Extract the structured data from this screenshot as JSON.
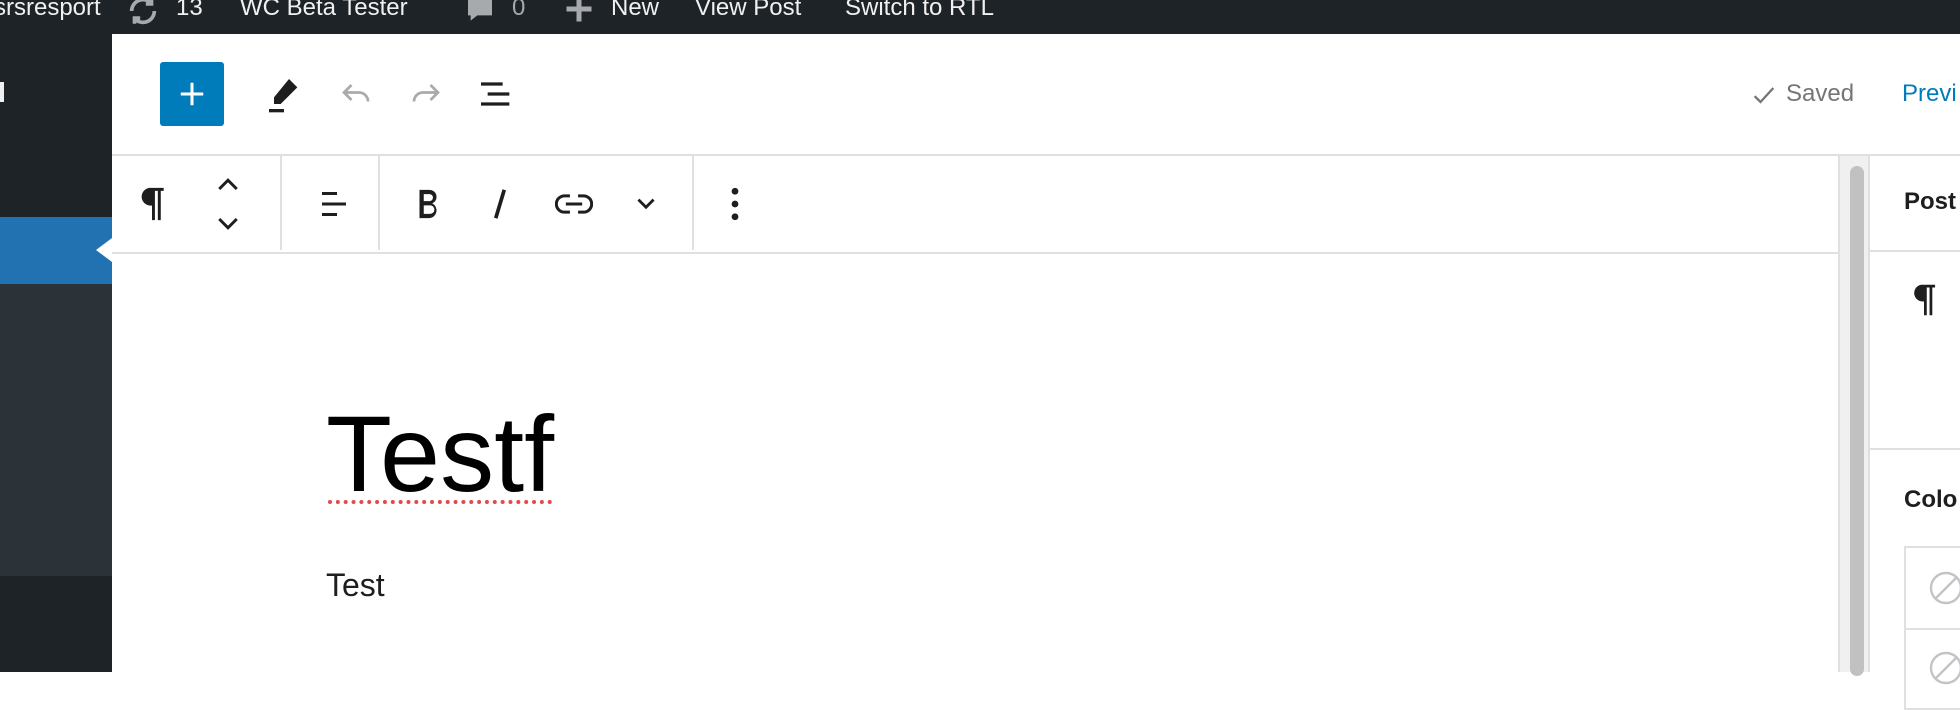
{
  "admin_bar": {
    "site_name": "srsresport",
    "updates_count": "13",
    "plugin_link": "WC Beta Tester",
    "comments_count": "0",
    "new_label": "New",
    "view_post_label": "View Post",
    "rtl_label": "Switch to RTL"
  },
  "header": {
    "saved_label": "Saved",
    "preview_label": "Previ"
  },
  "editor": {
    "title": "Testf",
    "paragraph": "Test"
  },
  "sidebar": {
    "tab_label": "Post",
    "color_heading": "Colo"
  },
  "colors": {
    "accent": "#007cba",
    "admin_bar": "#1d2327",
    "menu_active": "#2271b1",
    "spellcheck": "#e34a4a"
  }
}
